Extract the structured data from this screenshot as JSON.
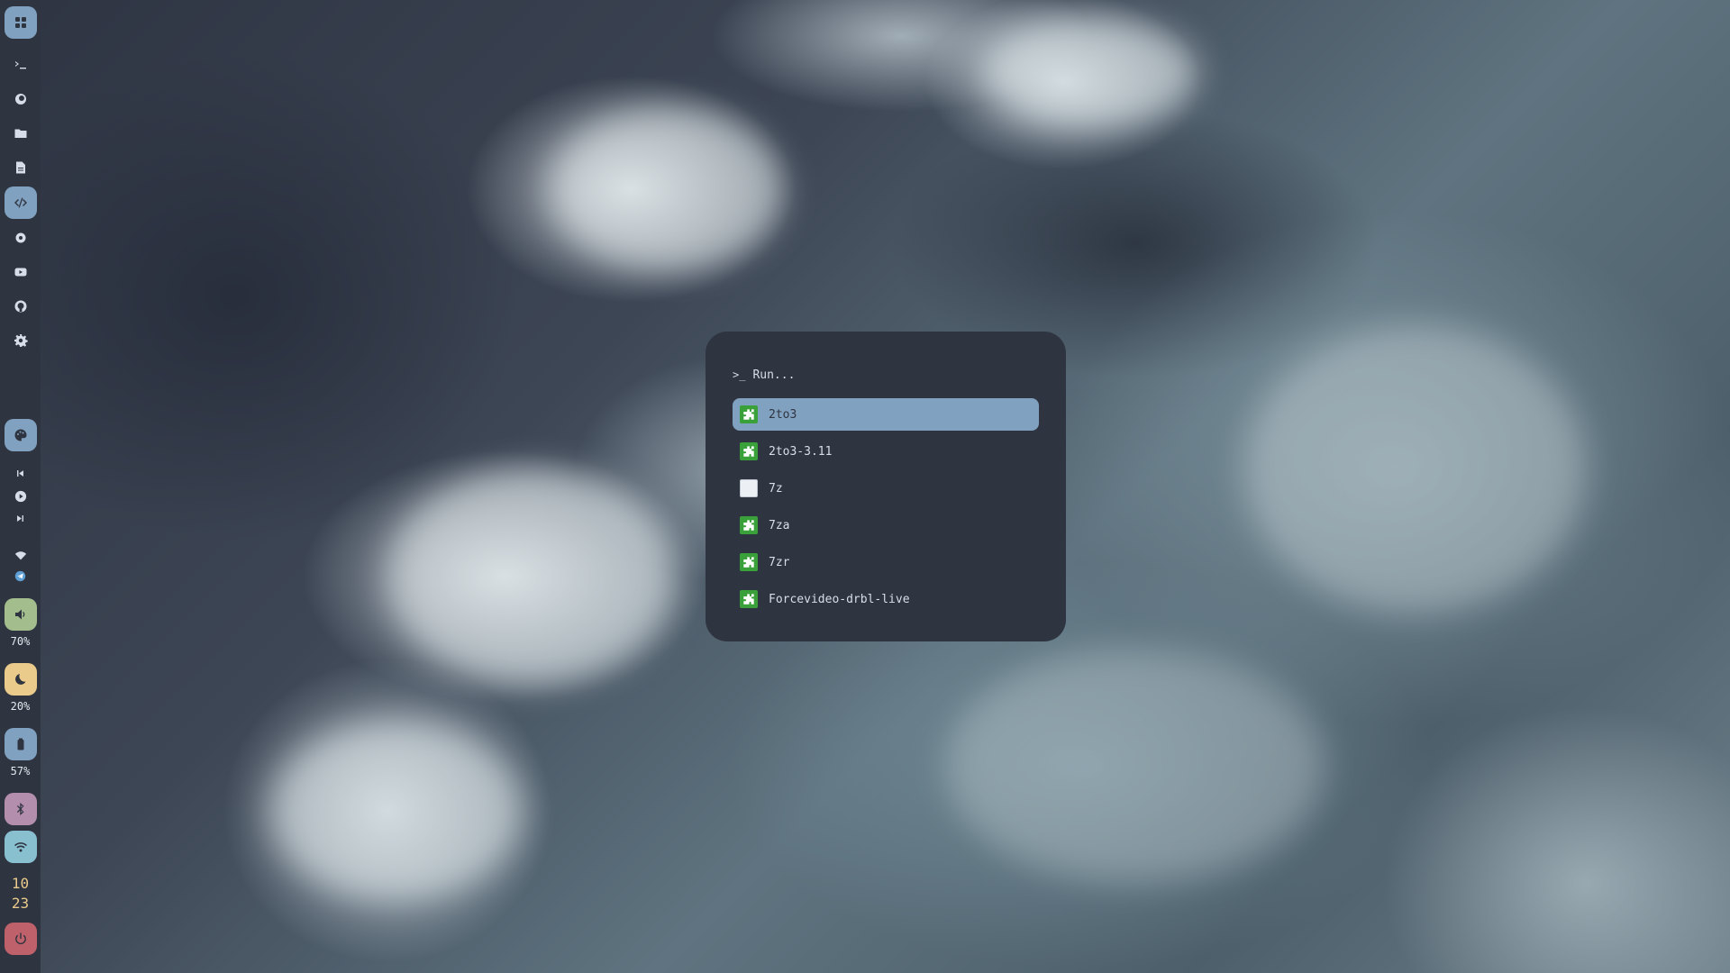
{
  "sidebar": {
    "top_icons": [
      {
        "name": "apps-grid-icon"
      },
      {
        "name": "terminal-icon"
      },
      {
        "name": "firefox-icon"
      },
      {
        "name": "folder-icon"
      },
      {
        "name": "document-icon"
      },
      {
        "name": "code-icon"
      },
      {
        "name": "settings-icon"
      },
      {
        "name": "youtube-icon"
      },
      {
        "name": "github-icon"
      },
      {
        "name": "cog-icon"
      }
    ],
    "volume": {
      "value": "70%",
      "color": "#a3be8c"
    },
    "night_light": {
      "value": "20%",
      "color": "#ebcb8b"
    },
    "battery": {
      "value": "57%",
      "color": "#81a1c1"
    },
    "bluetooth": {
      "color": "#b48ead"
    },
    "wifi": {
      "color": "#88c0d0"
    },
    "clock": {
      "hour": "10",
      "minute": "23"
    },
    "power": {
      "color": "#bf616a"
    }
  },
  "run_dialog": {
    "title": "Run...",
    "prompt_symbol": ">_",
    "items": [
      {
        "label": "2to3",
        "icon": "plugin",
        "selected": true
      },
      {
        "label": "2to3-3.11",
        "icon": "plugin",
        "selected": false
      },
      {
        "label": "7z",
        "icon": "blank",
        "selected": false
      },
      {
        "label": "7za",
        "icon": "plugin",
        "selected": false
      },
      {
        "label": "7zr",
        "icon": "plugin",
        "selected": false
      },
      {
        "label": "Forcevideo-drbl-live",
        "icon": "plugin",
        "selected": false
      }
    ]
  },
  "colors": {
    "panel": "#2e3440",
    "accent": "#81a1c1",
    "text": "#d8dee9"
  }
}
